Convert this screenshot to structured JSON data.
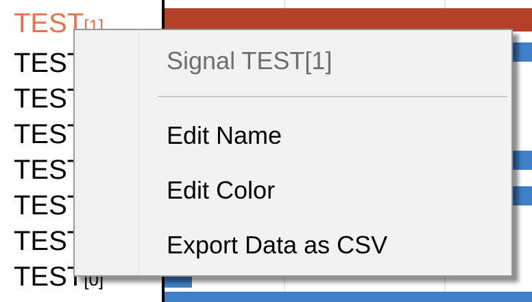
{
  "signal_list": {
    "items": [
      {
        "name": "TEST",
        "index": "[1]",
        "selected": true
      },
      {
        "name": "TEST",
        "index": "",
        "selected": false
      },
      {
        "name": "TEST",
        "index": "",
        "selected": false
      },
      {
        "name": "TEST",
        "index": "",
        "selected": false
      },
      {
        "name": "TEST",
        "index": "",
        "selected": false
      },
      {
        "name": "TEST",
        "index": "",
        "selected": false
      },
      {
        "name": "TEST",
        "index": "",
        "selected": false
      },
      {
        "name": "TEST",
        "index": "[0]",
        "selected": false
      }
    ]
  },
  "context_menu": {
    "header": "Signal TEST[1]",
    "items": [
      {
        "label": "Edit Name"
      },
      {
        "label": "Edit Color"
      },
      {
        "label": "Export Data as CSV"
      }
    ]
  },
  "colors": {
    "selected_signal_text": "#e8724a",
    "selected_wave": "#b5402a",
    "wave": "#3f7fc7",
    "menu_background": "#f2f2f2"
  }
}
